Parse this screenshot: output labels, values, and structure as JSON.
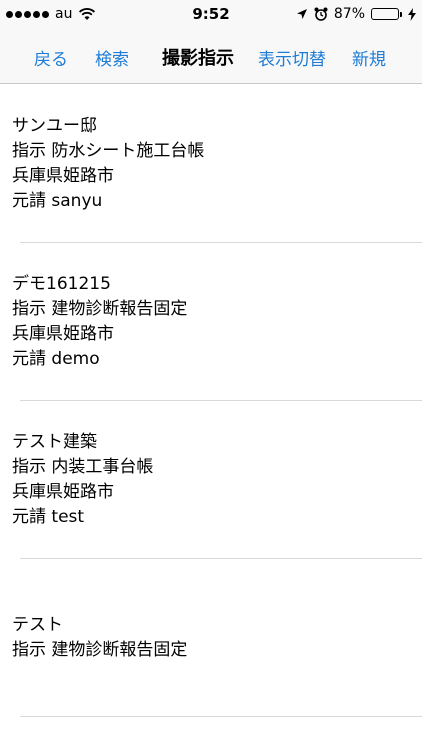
{
  "status_bar": {
    "carrier": "au",
    "time": "9:52",
    "battery_percent": "87%",
    "battery_level": 0.87,
    "signal_bars": 5
  },
  "nav": {
    "back_label": "戻る",
    "search_label": "検索",
    "title": "撮影指示",
    "toggle_label": "表示切替",
    "new_label": "新規",
    "accent_color": "#1e7cd6"
  },
  "items": [
    {
      "name": "サンユー邸",
      "instruction": "指示 防水シート施工台帳",
      "location": "兵庫県姫路市",
      "contractor": "元請 sanyu"
    },
    {
      "name": "デモ161215",
      "instruction": "指示 建物診断報告固定",
      "location": "兵庫県姫路市",
      "contractor": "元請 demo"
    },
    {
      "name": "テスト建築",
      "instruction": "指示 内装工事台帳",
      "location": "兵庫県姫路市",
      "contractor": "元請 test"
    },
    {
      "name": "テスト",
      "instruction": "指示 建物診断報告固定"
    }
  ]
}
